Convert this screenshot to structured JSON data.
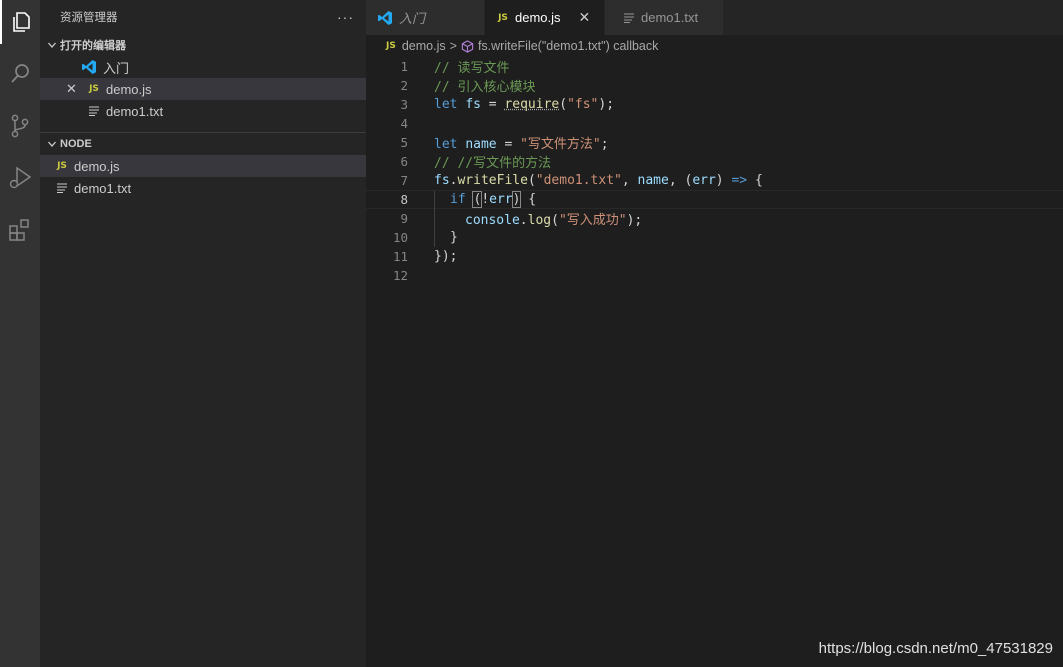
{
  "sidebar": {
    "title": "资源管理器",
    "more": "···",
    "open_editors": {
      "title": "打开的编辑器",
      "items": [
        {
          "label": "入门"
        },
        {
          "close": "✕",
          "badge": "JS",
          "label": "demo.js"
        },
        {
          "label": "demo1.txt"
        }
      ]
    },
    "folder": {
      "title": "NODE",
      "items": [
        {
          "badge": "JS",
          "label": "demo.js"
        },
        {
          "label": "demo1.txt"
        }
      ]
    }
  },
  "tabs": [
    {
      "label": "入门",
      "state": "inactive"
    },
    {
      "badge": "JS",
      "label": "demo.js",
      "state": "active",
      "close": "✕"
    },
    {
      "label": "demo1.txt",
      "state": "inactive"
    }
  ],
  "breadcrumb": {
    "badge": "JS",
    "file": "demo.js",
    "sep": ">",
    "symbol": "fs.writeFile(\"demo1.txt\") callback"
  },
  "editor": {
    "current_line": 8,
    "line_numbers": [
      "1",
      "2",
      "3",
      "4",
      "5",
      "6",
      "7",
      "8",
      "9",
      "10",
      "11",
      "12"
    ],
    "code": {
      "l1": "// 读写文件",
      "l2": "// 引入核心模块",
      "l3_let": "let",
      "l3_var": "fs",
      "l3_eq": "=",
      "l3_fn": "require",
      "l3_open": "(",
      "l3_str": "\"fs\"",
      "l3_close": ");",
      "l5_let": "let",
      "l5_var": "name",
      "l5_eq": "=",
      "l5_str": "\"写文件方法\"",
      "l5_end": ";",
      "l6": "// //写文件的方法",
      "l7_obj": "fs",
      "l7_dot": ".",
      "l7_fn": "writeFile",
      "l7_open": "(",
      "l7_str": "\"demo1.txt\"",
      "l7_comma": ",",
      "l7_var": "name",
      "l7_comma2": ",",
      "l7_p1": "(",
      "l7_err": "err",
      "l7_p2": ")",
      "l7_arrow": "=>",
      "l7_brace": "{",
      "l8_if": "if",
      "l8_open": "(",
      "l8_not": "!",
      "l8_err": "err",
      "l8_close": ")",
      "l8_brace": "{",
      "l9_obj": "console",
      "l9_dot": ".",
      "l9_fn": "log",
      "l9_open": "(",
      "l9_str": "\"写入成功\"",
      "l9_close": ");",
      "l10": "}",
      "l11": "});"
    }
  },
  "watermark": "https://blog.csdn.net/m0_47531829",
  "colors": {
    "activity_bar": "#333333",
    "sidebar": "#252526",
    "editor_bg": "#1e1e1e",
    "selection": "#37373d",
    "js_badge": "#cbcb41",
    "vscode_blue": "#23a9f2",
    "comment": "#6a9955",
    "keyword": "#569cd6",
    "string": "#ce9178"
  },
  "icons": {
    "activity": [
      "files-icon",
      "search-icon",
      "source-control-icon",
      "run-debug-icon",
      "extensions-icon"
    ]
  }
}
